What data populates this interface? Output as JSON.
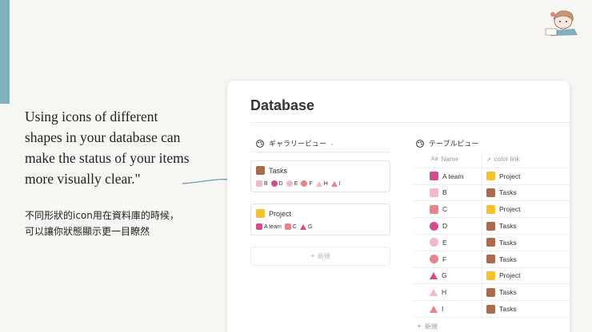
{
  "colors": {
    "accent": "#7fb1bd",
    "pink_light": "#f2b8c6",
    "pink_mid": "#e8838a",
    "pink_deep": "#d94a8c",
    "brown": "#a86b4e",
    "yellow": "#f2c12e"
  },
  "quote": {
    "line1": "Using icons of different",
    "line2": "shapes in your database can",
    "line3": "make the status of your items",
    "line4": "more visually clear.\""
  },
  "jp_note": {
    "line1": "不同形狀的icon用在資料庫的時候，",
    "line2": "可以讓你狀態顯示更一目瞭然"
  },
  "database": {
    "title": "Database",
    "gallery_view_label": "ギャラリービュー",
    "table_view_label": "テーブルビュー",
    "cards": [
      {
        "title": "Tasks",
        "icon": "brown-square",
        "items": [
          {
            "label": "B",
            "shape": "square",
            "color": "pink_light"
          },
          {
            "label": "D",
            "shape": "circle",
            "color": "pink_deep"
          },
          {
            "label": "E",
            "shape": "circle",
            "color": "pink_light"
          },
          {
            "label": "F",
            "shape": "circle",
            "color": "pink_mid"
          },
          {
            "label": "H",
            "shape": "triangle",
            "color": "pink_light"
          },
          {
            "label": "I",
            "shape": "triangle",
            "color": "pink_mid"
          }
        ]
      },
      {
        "title": "Project",
        "icon": "yellow-square",
        "items": [
          {
            "label": "A team",
            "shape": "square",
            "color": "pink_deep"
          },
          {
            "label": "C",
            "shape": "square",
            "color": "pink_mid"
          },
          {
            "label": "G",
            "shape": "triangle",
            "color": "pink_deep"
          }
        ]
      }
    ],
    "add_new_label": "新規",
    "table": {
      "col_name": "Name",
      "col_name_prefix": "Aa",
      "col_link": "color link",
      "rows": [
        {
          "name": "A team",
          "shape": "square",
          "color": "pink_deep",
          "link": "Project",
          "link_color": "yellow"
        },
        {
          "name": "B",
          "shape": "square",
          "color": "pink_light",
          "link": "Tasks",
          "link_color": "brown"
        },
        {
          "name": "C",
          "shape": "square",
          "color": "pink_mid",
          "link": "Project",
          "link_color": "yellow"
        },
        {
          "name": "D",
          "shape": "circle",
          "color": "pink_deep",
          "link": "Tasks",
          "link_color": "brown"
        },
        {
          "name": "E",
          "shape": "circle",
          "color": "pink_light",
          "link": "Tasks",
          "link_color": "brown"
        },
        {
          "name": "F",
          "shape": "circle",
          "color": "pink_mid",
          "link": "Tasks",
          "link_color": "brown"
        },
        {
          "name": "G",
          "shape": "triangle",
          "color": "pink_deep",
          "link": "Project",
          "link_color": "yellow"
        },
        {
          "name": "H",
          "shape": "triangle",
          "color": "pink_light",
          "link": "Tasks",
          "link_color": "brown"
        },
        {
          "name": "I",
          "shape": "triangle",
          "color": "pink_mid",
          "link": "Tasks",
          "link_color": "brown"
        }
      ],
      "new_label": "新規"
    }
  }
}
